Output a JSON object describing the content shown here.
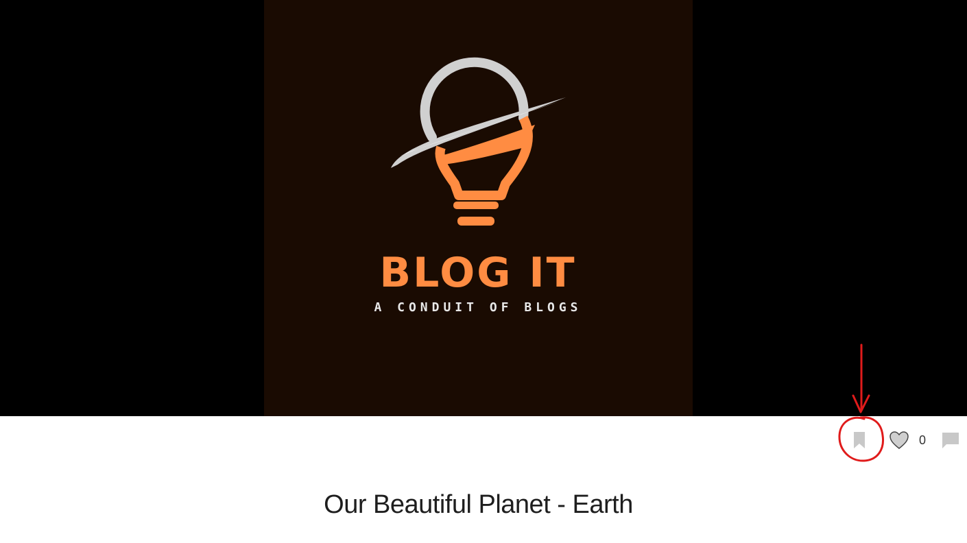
{
  "hero": {
    "logo": {
      "title": "BLOG IT",
      "subtitle": "A CONDUIT OF BLOGS",
      "colors": {
        "background": "#1a0b02",
        "accent": "#ff8c42",
        "ring": "#d0d0d0"
      },
      "icon": "lightbulb-planet-icon"
    }
  },
  "post_actions": {
    "bookmark_icon": "bookmark-icon",
    "like_icon": "heart-icon",
    "like_count": "0",
    "comment_icon": "comment-icon"
  },
  "annotation": {
    "color": "#e01b1b",
    "shape": "arrow-and-circle",
    "target": "bookmark-button"
  },
  "post": {
    "title": "Our Beautiful Planet - Earth"
  }
}
